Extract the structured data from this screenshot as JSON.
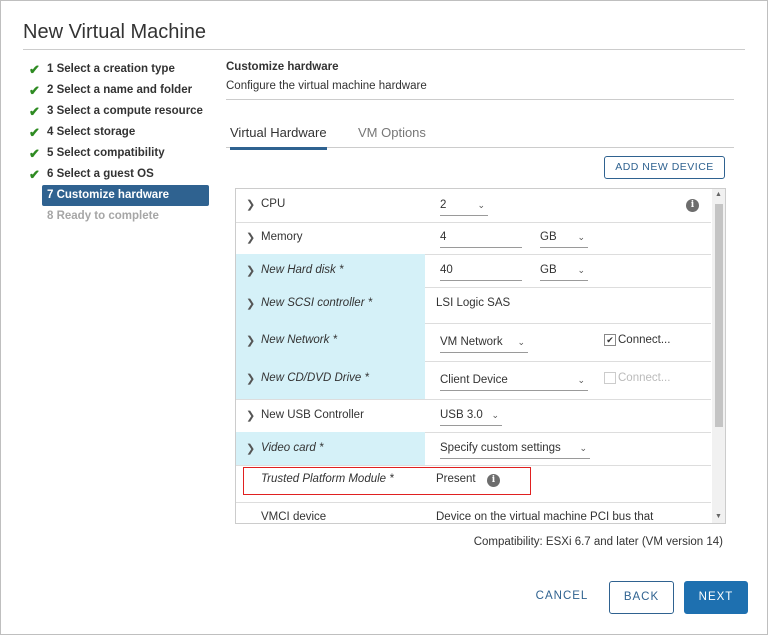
{
  "dialog": {
    "title": "New Virtual Machine"
  },
  "steps": [
    {
      "label": "1 Select a creation type",
      "state": "done"
    },
    {
      "label": "2 Select a name and folder",
      "state": "done"
    },
    {
      "label": "3 Select a compute resource",
      "state": "done"
    },
    {
      "label": "4 Select storage",
      "state": "done"
    },
    {
      "label": "5 Select compatibility",
      "state": "done"
    },
    {
      "label": "6 Select a guest OS",
      "state": "done"
    },
    {
      "label": "7 Customize hardware",
      "state": "active"
    },
    {
      "label": "8 Ready to complete",
      "state": "disabled"
    }
  ],
  "content": {
    "heading": "Customize hardware",
    "subheading": "Configure the virtual machine hardware"
  },
  "tabs": [
    {
      "label": "Virtual Hardware",
      "active": true
    },
    {
      "label": "VM Options",
      "active": false
    }
  ],
  "toolbar": {
    "add_new_device": "ADD NEW DEVICE"
  },
  "hardware": {
    "cpu": {
      "label": "CPU",
      "value": "2"
    },
    "memory": {
      "label": "Memory",
      "value": "4",
      "unit": "GB"
    },
    "hard_disk": {
      "label": "New Hard disk *",
      "value": "40",
      "unit": "GB"
    },
    "scsi": {
      "label": "New SCSI controller *",
      "value": "LSI Logic SAS"
    },
    "network": {
      "label": "New Network *",
      "value": "VM Network",
      "connect_label": "Connect..."
    },
    "cdrom": {
      "label": "New CD/DVD Drive *",
      "value": "Client Device",
      "connect_label": "Connect..."
    },
    "usb": {
      "label": "New USB Controller",
      "value": "USB 3.0"
    },
    "video": {
      "label": "Video card *",
      "value": "Specify custom settings"
    },
    "tpm": {
      "label": "Trusted Platform Module *",
      "value": "Present"
    },
    "vmci": {
      "label": "VMCI device",
      "value": "Device on the virtual machine PCI bus that"
    }
  },
  "footer": {
    "compatibility": "Compatibility: ESXi 6.7 and later (VM version 14)",
    "cancel": "CANCEL",
    "back": "BACK",
    "next": "NEXT"
  },
  "icons": {
    "check": "check-icon",
    "info": "info-icon",
    "chevron": "chevron-right-icon",
    "dropdown": "chevron-down-icon"
  },
  "colors": {
    "accent": "#2f6290",
    "primary_button": "#1e70b0",
    "changed_row": "#d5f1f8",
    "check": "#2e8b22",
    "highlight": "#e02020"
  }
}
